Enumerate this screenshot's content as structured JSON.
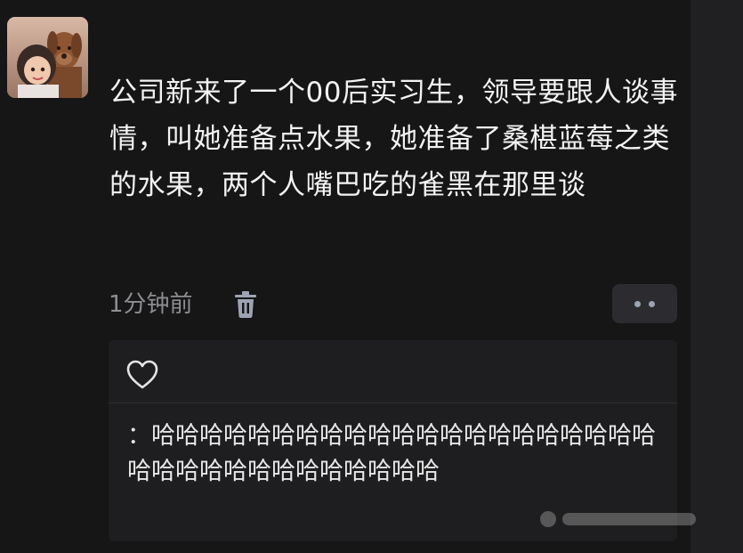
{
  "post": {
    "avatar_icon": "user-avatar",
    "text": "公司新来了一个00后实习生，领导要跟人谈事情，叫她准备点水果，她准备了桑椹蓝莓之类的水果，两个人嘴巴吃的雀黑在那里谈",
    "time": "1分钟前",
    "delete_icon": "trash-icon",
    "more_icon": "more-dots-icon"
  },
  "comments": {
    "like_icon": "heart-outline-icon",
    "items": [
      {
        "text": "：哈哈哈哈哈哈哈哈哈哈哈哈哈哈哈哈哈哈哈哈哈哈哈哈哈哈哈哈哈哈哈哈哈哈"
      }
    ]
  },
  "colors": {
    "background": "#161617",
    "text_primary": "#f3f3f3",
    "text_secondary": "#8d8d92",
    "button_bg": "#2c2c30",
    "comment_bg": "#1e1e20"
  }
}
